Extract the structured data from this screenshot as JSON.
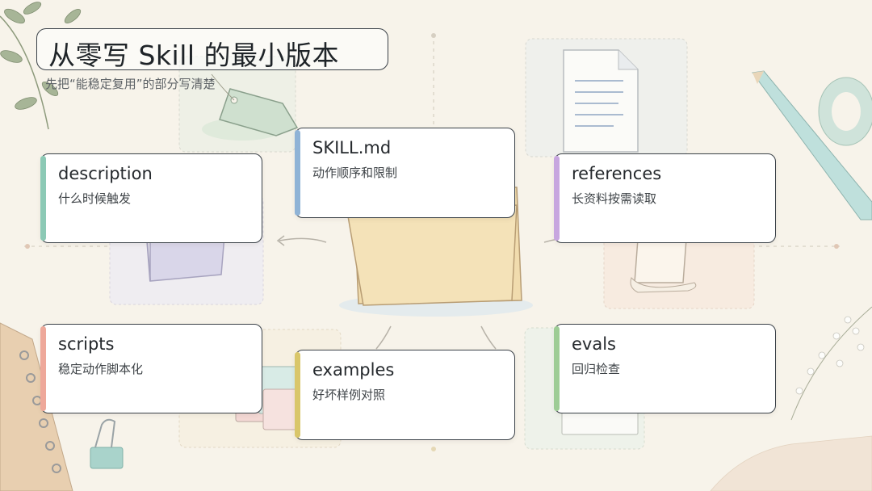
{
  "header": {
    "title": "从零写 Skill 的最小版本",
    "subtitle": "先把“能稳定复用”的部分写清楚"
  },
  "cards": [
    {
      "id": "skill-md",
      "title": "SKILL.md",
      "desc": "动作顺序和限制",
      "color": "#8fb3d6"
    },
    {
      "id": "description",
      "title": "description",
      "desc": "什么时候触发",
      "color": "#8cc9b5"
    },
    {
      "id": "references",
      "title": "references",
      "desc": "长资料按需读取",
      "color": "#c7a6df"
    },
    {
      "id": "scripts",
      "title": "scripts",
      "desc": "稳定动作脚本化",
      "color": "#eea89a"
    },
    {
      "id": "examples",
      "title": "examples",
      "desc": "好坏样例对照",
      "color": "#d9c66a"
    },
    {
      "id": "evals",
      "title": "evals",
      "desc": "回归检查",
      "color": "#9dcc95"
    }
  ],
  "icons": [
    "folder-icon",
    "document-icon",
    "tag-icon",
    "scroll-icon",
    "book-icon",
    "cards-icon",
    "pencil-icon",
    "tape-icon",
    "paperclip-icon",
    "notebook-icon",
    "plant-icon"
  ]
}
